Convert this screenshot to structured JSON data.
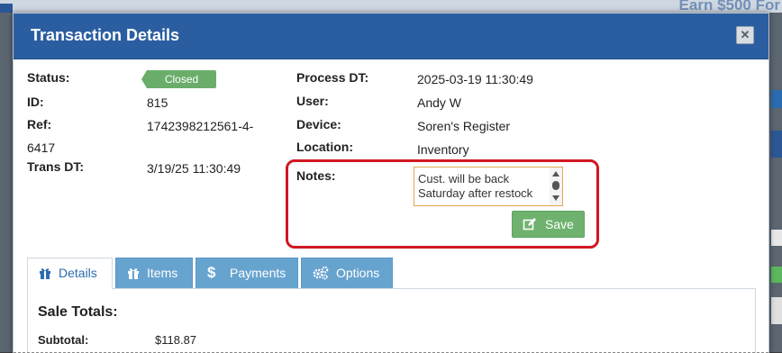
{
  "background": {
    "banner_text": "Earn $500 For"
  },
  "modal": {
    "title": "Transaction Details",
    "close_icon": "close-icon"
  },
  "fields": {
    "status_label": "Status:",
    "status_value": "Closed",
    "id_label": "ID:",
    "id_value": "815",
    "ref_label": "Ref:",
    "ref_value_line1": "1742398212561-4-",
    "ref_value_line2": "6417",
    "trans_dt_label": "Trans DT:",
    "trans_dt_value": "3/19/25 11:30:49",
    "process_dt_label": "Process DT:",
    "process_dt_value": "2025-03-19 11:30:49",
    "user_label": "User:",
    "user_value": "Andy W",
    "device_label": "Device:",
    "device_value": "Soren's Register",
    "location_label": "Location:",
    "location_value": "Inventory",
    "notes_label": "Notes:",
    "notes_value": "Cust. will be back Saturday after restock",
    "save_label": "Save"
  },
  "tabs": [
    {
      "label": "Details",
      "icon": "gift-icon",
      "active": true
    },
    {
      "label": "Items",
      "icon": "gift-icon",
      "active": false
    },
    {
      "label": "Payments",
      "icon": "dollar-icon",
      "active": false
    },
    {
      "label": "Options",
      "icon": "gears-icon",
      "active": false
    }
  ],
  "details": {
    "sale_totals_title": "Sale Totals:",
    "subtotal_label": "Subtotal:",
    "subtotal_value": "$118.87"
  },
  "colors": {
    "header": "#2b5ea1",
    "closed_badge": "#6aad6a",
    "save_button": "#6fb26f",
    "tab": "#67a3cf",
    "highlight": "#d01822"
  }
}
